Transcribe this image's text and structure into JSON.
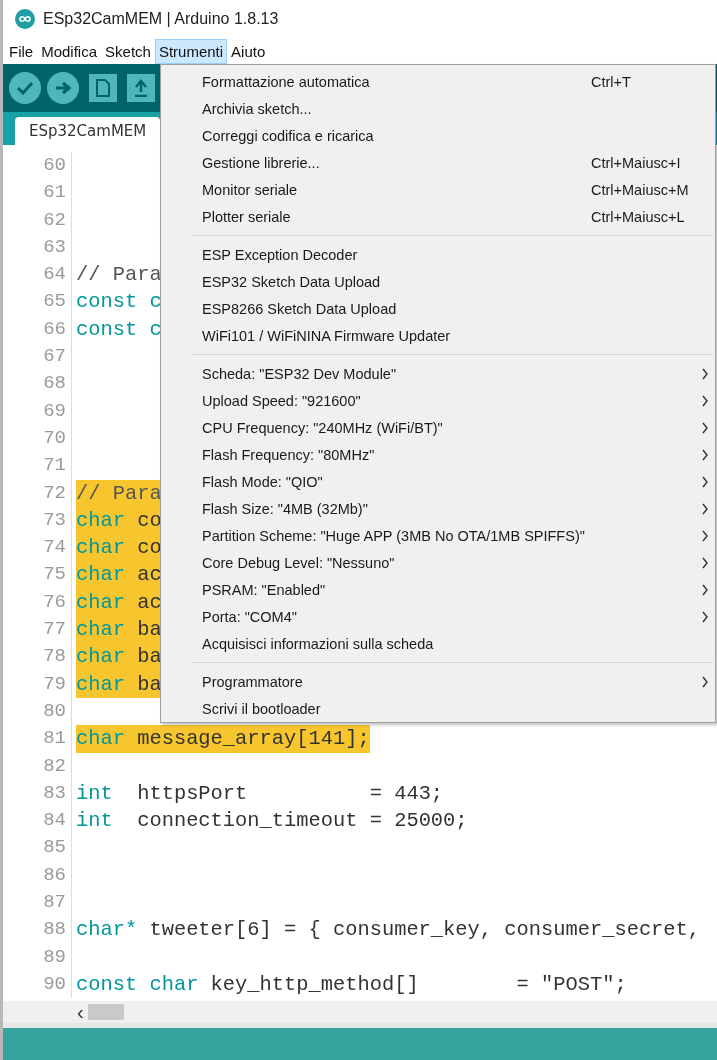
{
  "window": {
    "title": "ESp32CamMEM | Arduino 1.8.13"
  },
  "menubar": [
    {
      "label": "File",
      "selected": false
    },
    {
      "label": "Modifica",
      "selected": false
    },
    {
      "label": "Sketch",
      "selected": false
    },
    {
      "label": "Strumenti",
      "selected": true
    },
    {
      "label": "Aiuto",
      "selected": false
    }
  ],
  "toolbar": [
    {
      "kind": "verify"
    },
    {
      "kind": "upload"
    },
    {
      "kind": "new"
    },
    {
      "kind": "open"
    }
  ],
  "tabs": [
    {
      "label": "ESp32CamMEM",
      "selected": true
    }
  ],
  "editor": {
    "lines": [
      {
        "number": "60"
      },
      {
        "number": "61"
      },
      {
        "number": "62"
      },
      {
        "number": "63"
      },
      {
        "number": "64",
        "highlighted": false,
        "tokens": [
          {
            "kind": "comment",
            "text": "// Para"
          }
        ]
      },
      {
        "number": "65",
        "highlighted": false,
        "tokens": [
          {
            "kind": "keyword",
            "text": "const c"
          }
        ]
      },
      {
        "number": "66",
        "highlighted": false,
        "tokens": [
          {
            "kind": "keyword",
            "text": "const c"
          }
        ]
      },
      {
        "number": "67"
      },
      {
        "number": "68"
      },
      {
        "number": "69"
      },
      {
        "number": "70"
      },
      {
        "number": "71"
      },
      {
        "number": "72",
        "highlighted": true,
        "tokens": [
          {
            "kind": "comment",
            "text": "// Para"
          }
        ]
      },
      {
        "number": "73",
        "highlighted": true,
        "tokens": [
          {
            "kind": "keyword",
            "text": "char"
          },
          {
            "kind": "plain",
            "text": " co"
          }
        ]
      },
      {
        "number": "74",
        "highlighted": true,
        "tokens": [
          {
            "kind": "keyword",
            "text": "char"
          },
          {
            "kind": "plain",
            "text": " co"
          }
        ]
      },
      {
        "number": "75",
        "highlighted": true,
        "tokens": [
          {
            "kind": "keyword",
            "text": "char"
          },
          {
            "kind": "plain",
            "text": " ac"
          }
        ]
      },
      {
        "number": "76",
        "highlighted": true,
        "tokens": [
          {
            "kind": "keyword",
            "text": "char"
          },
          {
            "kind": "plain",
            "text": " ac"
          }
        ]
      },
      {
        "number": "77",
        "highlighted": true,
        "tokens": [
          {
            "kind": "keyword",
            "text": "char"
          },
          {
            "kind": "plain",
            "text": " ba"
          }
        ]
      },
      {
        "number": "78",
        "highlighted": true,
        "tokens": [
          {
            "kind": "keyword",
            "text": "char"
          },
          {
            "kind": "plain",
            "text": " ba"
          }
        ]
      },
      {
        "number": "79",
        "highlighted": true,
        "tokens": [
          {
            "kind": "keyword",
            "text": "char"
          },
          {
            "kind": "plain",
            "text": " ba"
          }
        ]
      },
      {
        "number": "80"
      },
      {
        "number": "81",
        "highlighted": true,
        "tokens": [
          {
            "kind": "keyword",
            "text": "char"
          },
          {
            "kind": "plain",
            "text": " message_array[141];"
          }
        ]
      },
      {
        "number": "82"
      },
      {
        "number": "83",
        "highlighted": false,
        "tokens": [
          {
            "kind": "keyword",
            "text": "int"
          },
          {
            "kind": "plain",
            "text": "  httpsPort          = 443;"
          }
        ]
      },
      {
        "number": "84",
        "highlighted": false,
        "tokens": [
          {
            "kind": "keyword",
            "text": "int"
          },
          {
            "kind": "plain",
            "text": "  connection_timeout = 25000;"
          }
        ]
      },
      {
        "number": "85"
      },
      {
        "number": "86"
      },
      {
        "number": "87"
      },
      {
        "number": "88",
        "highlighted": false,
        "tokens": [
          {
            "kind": "keyword",
            "text": "char*"
          },
          {
            "kind": "plain",
            "text": " tweeter[6] = { consumer_key, consumer_secret,"
          }
        ]
      },
      {
        "number": "89"
      },
      {
        "number": "90",
        "highlighted": false,
        "tokens": [
          {
            "kind": "keyword",
            "text": "const char"
          },
          {
            "kind": "plain",
            "text": " key_http_method[]        = \"POST\";"
          }
        ]
      }
    ]
  },
  "hscroll": {
    "arrow": "‹"
  },
  "menu": [
    {
      "kind": "item",
      "label": "Formattazione automatica",
      "shortcut": "Ctrl+T",
      "submenu": false
    },
    {
      "kind": "item",
      "label": "Archivia sketch...",
      "submenu": false
    },
    {
      "kind": "item",
      "label": "Correggi codifica e ricarica",
      "submenu": false
    },
    {
      "kind": "item",
      "label": "Gestione librerie...",
      "shortcut": "Ctrl+Maiusc+I",
      "submenu": false
    },
    {
      "kind": "item",
      "label": "Monitor seriale",
      "shortcut": "Ctrl+Maiusc+M",
      "submenu": false
    },
    {
      "kind": "item",
      "label": "Plotter seriale",
      "shortcut": "Ctrl+Maiusc+L",
      "submenu": false
    },
    {
      "kind": "separator"
    },
    {
      "kind": "item",
      "label": "ESP Exception Decoder",
      "submenu": false
    },
    {
      "kind": "item",
      "label": "ESP32 Sketch Data Upload",
      "submenu": false
    },
    {
      "kind": "item",
      "label": "ESP8266 Sketch Data Upload",
      "submenu": false
    },
    {
      "kind": "item",
      "label": "WiFi101 / WiFiNINA Firmware Updater",
      "submenu": false
    },
    {
      "kind": "separator"
    },
    {
      "kind": "item",
      "label": "Scheda: \"ESP32 Dev Module\"",
      "submenu": true
    },
    {
      "kind": "item",
      "label": "Upload Speed: \"921600\"",
      "submenu": true
    },
    {
      "kind": "item",
      "label": "CPU Frequency: \"240MHz (WiFi/BT)\"",
      "submenu": true
    },
    {
      "kind": "item",
      "label": "Flash Frequency: \"80MHz\"",
      "submenu": true
    },
    {
      "kind": "item",
      "label": "Flash Mode: \"QIO\"",
      "submenu": true
    },
    {
      "kind": "item",
      "label": "Flash Size: \"4MB (32Mb)\"",
      "submenu": true
    },
    {
      "kind": "item",
      "label": "Partition Scheme: \"Huge APP (3MB No OTA/1MB SPIFFS)\"",
      "submenu": true
    },
    {
      "kind": "item",
      "label": "Core Debug Level: \"Nessuno\"",
      "submenu": true
    },
    {
      "kind": "item",
      "label": "PSRAM: \"Enabled\"",
      "submenu": true
    },
    {
      "kind": "item",
      "label": "Porta: \"COM4\"",
      "submenu": true
    },
    {
      "kind": "item",
      "label": "Acquisisci informazioni sulla scheda",
      "submenu": false
    },
    {
      "kind": "separator"
    },
    {
      "kind": "item",
      "label": "Programmatore",
      "submenu": true
    },
    {
      "kind": "item",
      "label": "Scrivi il bootloader",
      "submenu": false
    }
  ]
}
